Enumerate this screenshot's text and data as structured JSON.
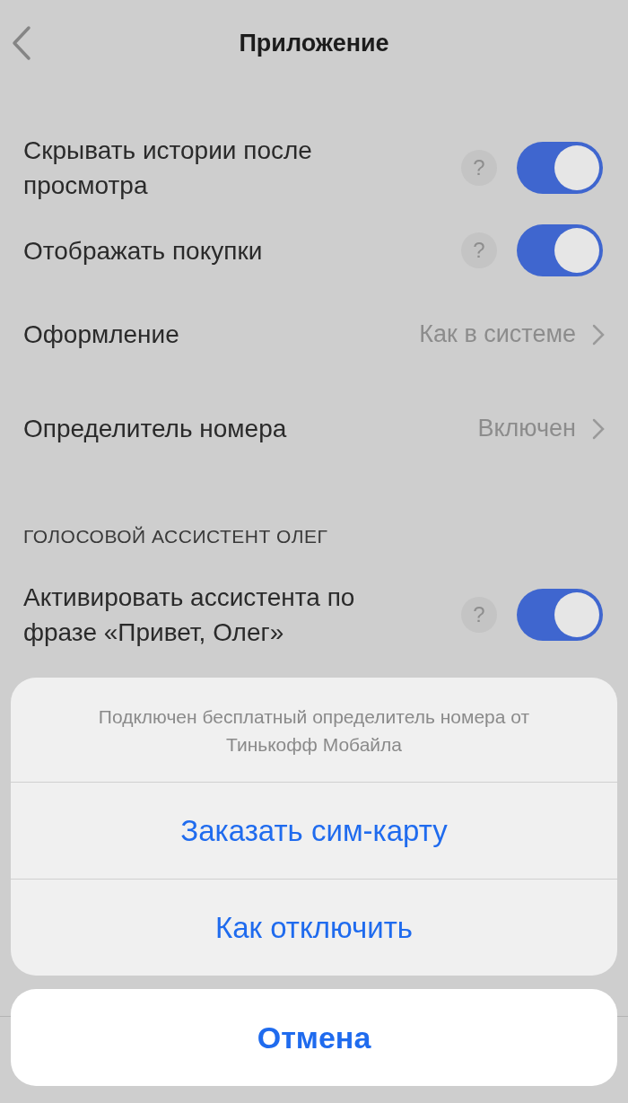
{
  "header": {
    "title": "Приложение"
  },
  "settings": [
    {
      "kind": "toggle",
      "label": "Скрывать истории после просмотра",
      "help": "?",
      "on": true
    },
    {
      "kind": "toggle",
      "label": "Отображать покупки",
      "help": "?",
      "on": true
    },
    {
      "kind": "link",
      "label": "Оформление",
      "value": "Как в системе"
    },
    {
      "kind": "link",
      "label": "Определитель номера",
      "value": "Включен"
    }
  ],
  "section": {
    "title": "ГОЛОСОВОЙ АССИСТЕНТ ОЛЕГ",
    "items": [
      {
        "kind": "toggle",
        "label": "Активировать ассистента по фразе «Привет, Олег»",
        "help": "?",
        "on": true
      }
    ]
  },
  "action_sheet": {
    "message": "Подключен бесплатный определитель номера от Тинькофф Мобайла",
    "actions": [
      "Заказать сим-карту",
      "Как отключить"
    ],
    "cancel": "Отмена"
  }
}
